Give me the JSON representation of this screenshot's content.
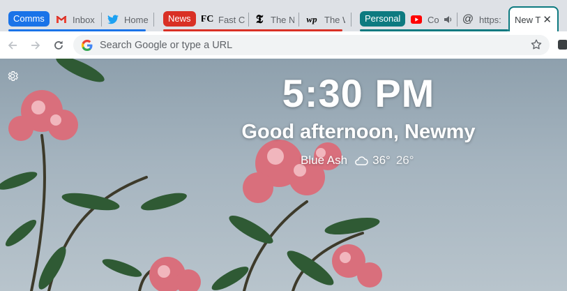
{
  "tab_groups": [
    {
      "label": "Comms",
      "color": "#1a73e8"
    },
    {
      "label": "News",
      "color": "#d93025"
    },
    {
      "label": "Personal",
      "color": "#0d7a80"
    }
  ],
  "tabs": [
    {
      "title": "Inbox",
      "icon": "gmail-icon"
    },
    {
      "title": "Home",
      "icon": "twitter-icon"
    },
    {
      "title": "Fast C",
      "icon": "fast-company-icon"
    },
    {
      "title": "The N",
      "icon": "nyt-icon"
    },
    {
      "title": "The W",
      "icon": "washington-post-icon"
    },
    {
      "title": "Co",
      "icon": "youtube-icon",
      "audio": true
    },
    {
      "title": "https:",
      "icon": "at-sign-icon"
    },
    {
      "title": "New T",
      "icon": "none",
      "active": true
    }
  ],
  "toolbar": {
    "search_placeholder": "Search Google or type a URL"
  },
  "page": {
    "time": "5:30 PM",
    "greeting": "Good afternoon, Newmy",
    "location": "Blue Ash",
    "temp_high": "36°",
    "temp_low": "26°",
    "weather_icon": "cloud-icon"
  },
  "colors": {
    "tabstrip": "#dee1e6",
    "active_border": "#0d7a80"
  }
}
